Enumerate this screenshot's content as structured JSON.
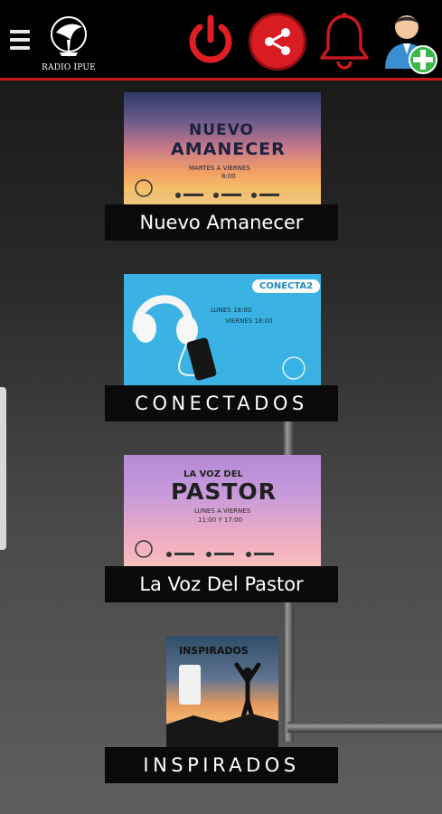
{
  "header": {
    "logo_text": "RADIO IPUE",
    "icons": [
      "menu-icon",
      "power-icon",
      "share-icon",
      "bell-icon",
      "add-user-icon"
    ],
    "accent": "#d81c22"
  },
  "programs": [
    {
      "label": "Nuevo Amanecer",
      "cover_title_1": "NUEVO",
      "cover_title_2": "AMANECER",
      "cover_schedule": "MARTES A VIERNES",
      "cover_time": "8:00"
    },
    {
      "label": "CONECTADOS",
      "cover_badge": "CONECTA2",
      "cover_line_1": "LUNES 18:00",
      "cover_line_2": "VIERNES 18:00"
    },
    {
      "label": "La Voz Del Pastor",
      "cover_title_1": "LA VOZ DEL",
      "cover_title_2": "PASTOR",
      "cover_schedule": "LUNES A VIERNES",
      "cover_time": "11:00 Y 17:00"
    },
    {
      "label": "INSPIRADOS",
      "cover_title": "INSPIRADOS"
    }
  ]
}
